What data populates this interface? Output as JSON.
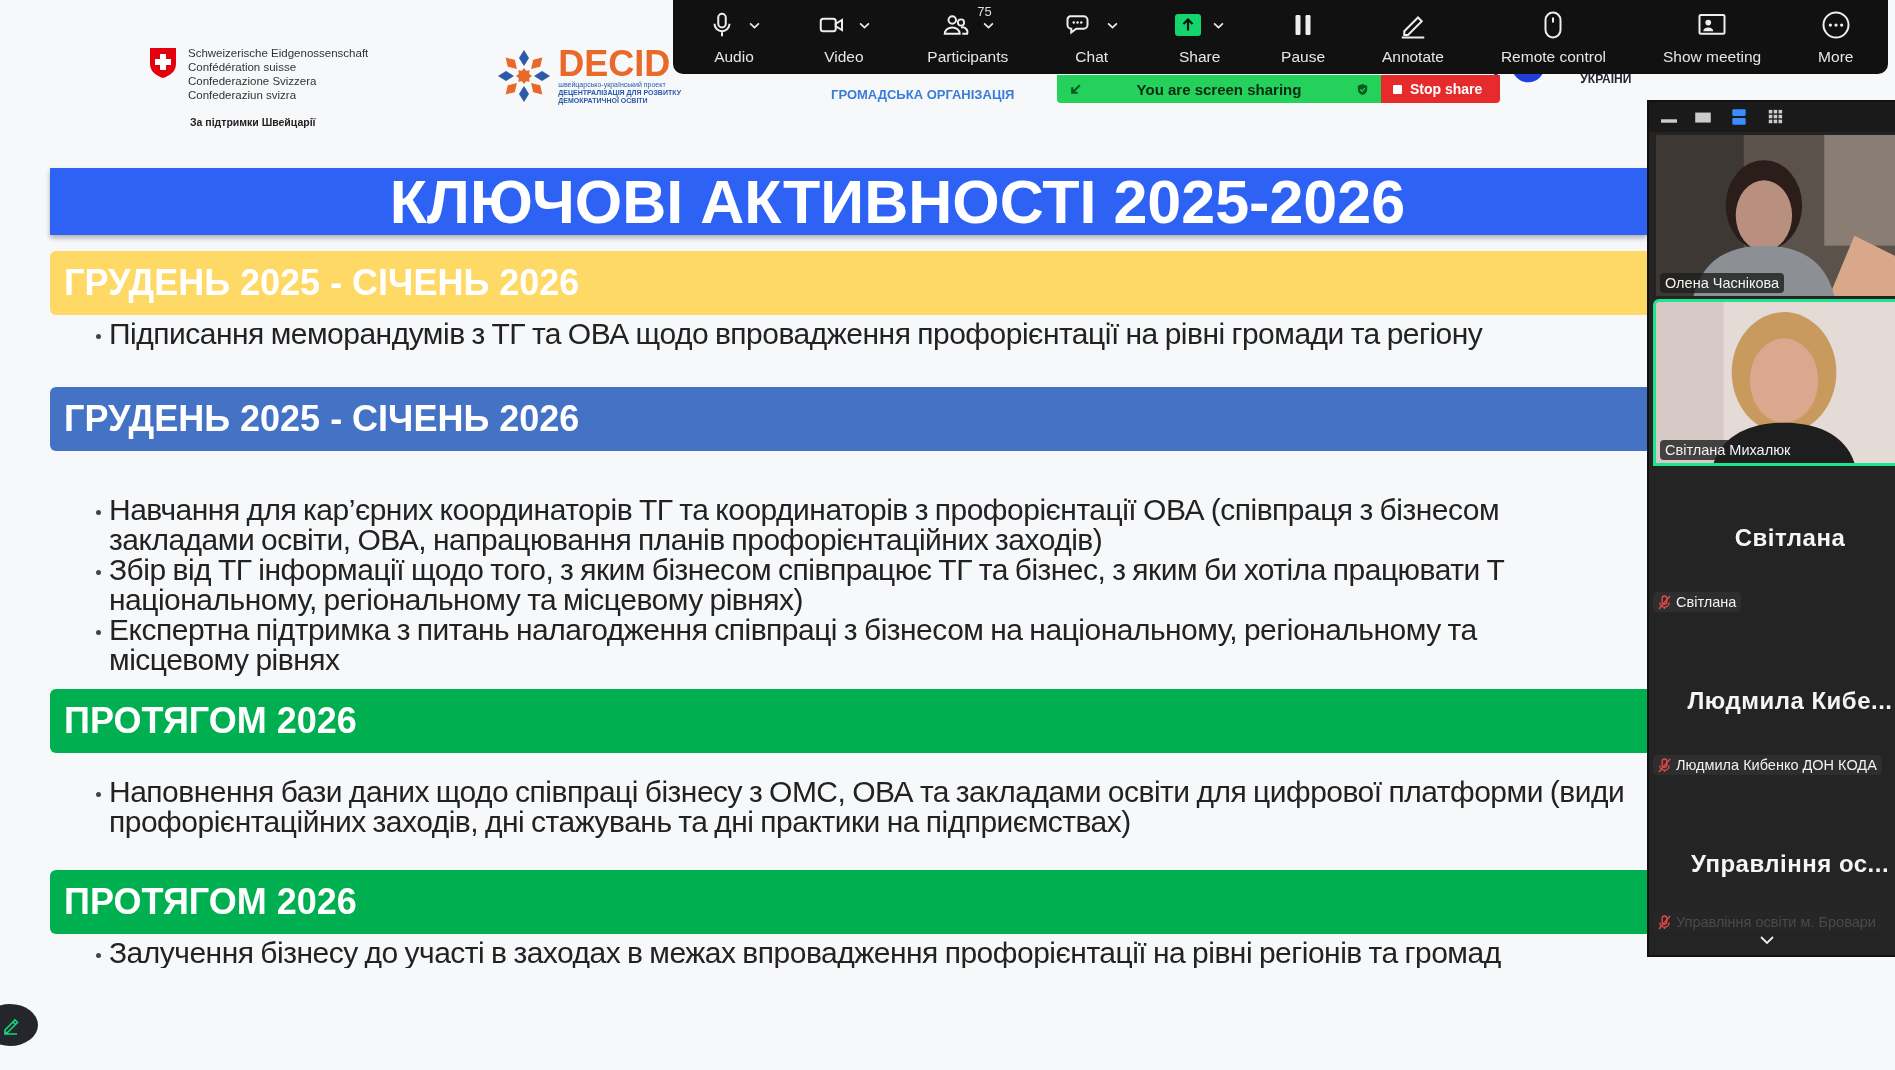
{
  "logos": {
    "swiss": {
      "lines": [
        "Schweizerische Eidgenossenschaft",
        "Confédération suisse",
        "Confederazione Svizzera",
        "Confederaziun svizra"
      ],
      "caption": "За підтримки Швейцарії"
    },
    "decide": {
      "name": "DECID",
      "lines": [
        "швейцарсько-український проект",
        "ДЕЦЕНТРАЛІЗАЦІЯ ДЛЯ РОЗВИТКУ",
        "ДЕМОКРАТИЧНОЇ ОСВІТИ"
      ]
    },
    "organization": "ГРОМАДСЬКА ОРГАНІЗАЦІЯ",
    "ukraine": "УКРАЇНИ"
  },
  "slide": {
    "title": "КЛЮЧОВІ АКТИВНОСТІ 2025-2026",
    "sections": [
      {
        "heading": "ГРУДЕНЬ 2025 - СІЧЕНЬ 2026",
        "color": "#ffd966",
        "bullets": [
          {
            "lines": [
              "Підписання меморандумів з ТГ та ОВА щодо впровадження профорієнтації на рівні громади та регіону"
            ]
          }
        ]
      },
      {
        "heading": "ГРУДЕНЬ 2025 - СІЧЕНЬ 2026",
        "color": "#4472c4",
        "bullets": [
          {
            "lines": [
              "Навчання для кар’єрних координаторів ТГ та координаторів з профорієнтації ОВА (співпраця з бізнесом",
              "закладами освіти, ОВА, напрацювання планів профорієнтаційних заходів)"
            ]
          },
          {
            "lines": [
              "Збір від ТГ інформації щодо того, з яким бізнесом співпрацює ТГ та бізнес, з яким би хотіла працювати Т",
              "національному, регіональному та місцевому рівнях)"
            ]
          },
          {
            "lines": [
              "Експертна підтримка з питань налагодження співпраці з бізнесом на національному, регіональному та",
              "місцевому рівнях"
            ]
          }
        ]
      },
      {
        "heading": "ПРОТЯГОМ 2026",
        "color": "#00b050",
        "bullets": [
          {
            "lines": [
              "Наповнення бази даних щодо співпраці бізнесу з ОМС, ОВА та закладами освіти для цифрової платформи (види",
              "профорієнтаційних заходів, дні стажувань та дні практики на підприємствах)"
            ]
          }
        ]
      },
      {
        "heading": "ПРОТЯГОМ 2026",
        "color": "#00b050",
        "bullets": [
          {
            "lines": [
              "Залучення бізнесу до участі в заходах в межах впровадження профорієнтації на рівні регіонів та громад"
            ]
          }
        ]
      }
    ]
  },
  "toolbar": [
    {
      "label": "Audio",
      "caret": true,
      "highlighted": false
    },
    {
      "label": "Video",
      "caret": true,
      "highlighted": false
    },
    {
      "label": "Participants",
      "caret": true,
      "highlighted": false,
      "count": "75"
    },
    {
      "label": "Chat",
      "caret": true,
      "highlighted": false
    },
    {
      "label": "Share",
      "caret": true,
      "highlighted": true
    },
    {
      "label": "Pause",
      "caret": false,
      "highlighted": false
    },
    {
      "label": "Annotate",
      "caret": false,
      "highlighted": false
    },
    {
      "label": "Remote control",
      "caret": false,
      "highlighted": false
    },
    {
      "label": "Show meeting",
      "caret": false,
      "highlighted": false
    },
    {
      "label": "More",
      "caret": false,
      "highlighted": false
    }
  ],
  "sharing_banner": {
    "status": "You are screen sharing",
    "stop_button": "Stop share"
  },
  "panel": {
    "views": [
      {
        "selected": false
      },
      {
        "selected": false
      },
      {
        "selected": true
      },
      {
        "selected": false
      }
    ],
    "tiles": [
      {
        "kind": "video",
        "name": "Олена Часнікова",
        "active_speaker": false
      },
      {
        "kind": "video",
        "name": "Світлана Михалюк",
        "active_speaker": true
      },
      {
        "kind": "avatar",
        "display": "Світлана",
        "name": "Світлана",
        "muted": true,
        "dimmed": false
      },
      {
        "kind": "avatar",
        "display": "Людмила Кибе...",
        "name": "Людмила Кибенко ДОН КОДА",
        "muted": true,
        "dimmed": false
      },
      {
        "kind": "avatar",
        "display": "Управління ос...",
        "name": "Управління освіти м. Бровари",
        "muted": true,
        "dimmed": true
      }
    ]
  }
}
